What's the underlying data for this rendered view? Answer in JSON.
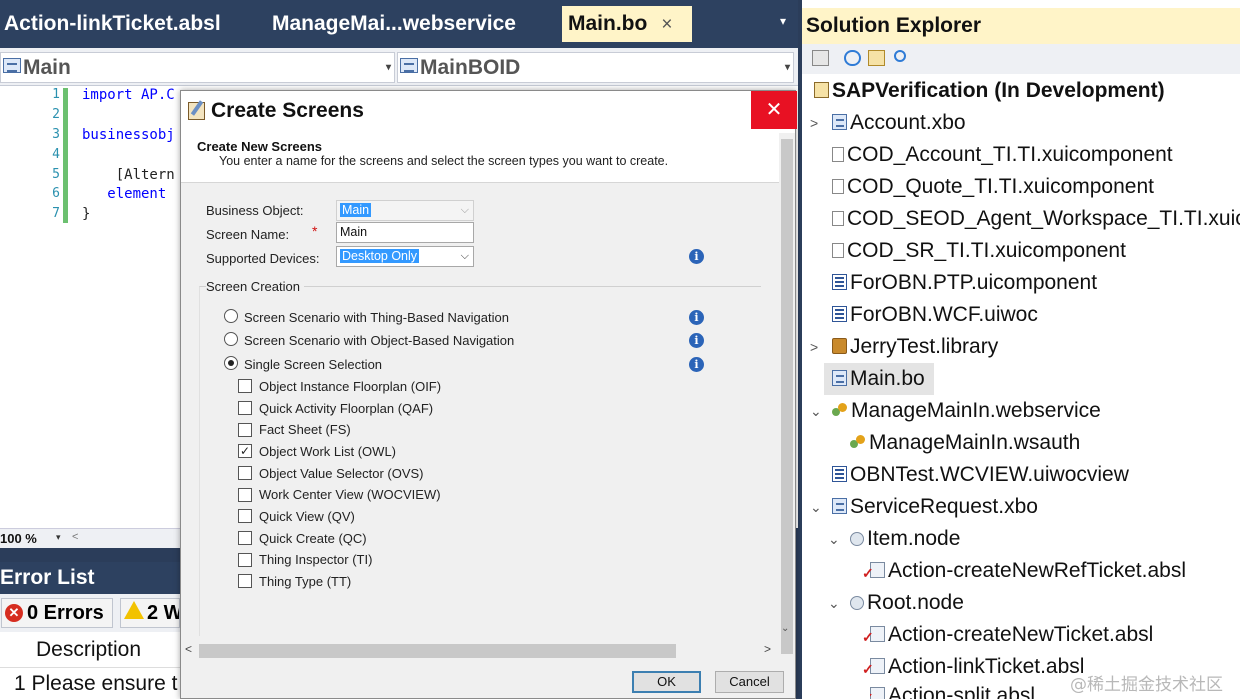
{
  "tabs": [
    {
      "label": "Action-linkTicket.absl"
    },
    {
      "label": "ManageMai...webservice"
    },
    {
      "label": "Main.bo",
      "close": "×"
    }
  ],
  "tab_menu": "▾",
  "nav": {
    "left": "Main",
    "right": "MainBOID",
    "arrow": "▾"
  },
  "code": {
    "line_numbers": [
      "1",
      "2",
      "3",
      "4",
      "5",
      "6",
      "7"
    ],
    "lines": [
      "import AP.C",
      "",
      "businessobj",
      "",
      "    [Altern",
      "   element",
      "}"
    ]
  },
  "zoom": {
    "value": "100 %",
    "arrow": "▾",
    "scroll_left": "<"
  },
  "error_list": {
    "title": "Error List",
    "errors_label": "0 Errors",
    "errors_icon": "✕",
    "warnings_label": "2 W",
    "column_description": "Description",
    "row_text": "1  Please ensure t"
  },
  "dialog": {
    "title": "Create Screens",
    "close": "✕",
    "header_title": "Create New Screens",
    "header_desc": "You enter a name for the screens and select the screen types you want to create.",
    "business_object_label": "Business Object:",
    "business_object_value": "Main",
    "screen_name_label": "Screen Name:",
    "required_mark": "*",
    "screen_name_value": "Main",
    "supported_devices_label": "Supported Devices:",
    "supported_devices_value": "Desktop Only",
    "combo_arrow": "⌵",
    "info_glyph": "i",
    "screen_creation_label": "Screen Creation",
    "radios": [
      {
        "label": "Screen Scenario with Thing-Based Navigation",
        "checked": false
      },
      {
        "label": "Screen Scenario with Object-Based Navigation",
        "checked": false
      },
      {
        "label": "Single Screen Selection",
        "checked": true
      }
    ],
    "checkboxes": [
      {
        "label": "Object Instance Floorplan (OIF)",
        "mark": ""
      },
      {
        "label": "Quick Activity Floorplan (QAF)",
        "mark": ""
      },
      {
        "label": "Fact Sheet (FS)",
        "mark": ""
      },
      {
        "label": "Object Work List (OWL)",
        "mark": "✓"
      },
      {
        "label": "Object Value Selector (OVS)",
        "mark": ""
      },
      {
        "label": "Work Center View (WOCVIEW)",
        "mark": ""
      },
      {
        "label": "Quick View (QV)",
        "mark": ""
      },
      {
        "label": "Quick Create (QC)",
        "mark": ""
      },
      {
        "label": "Thing Inspector (TI)",
        "mark": ""
      },
      {
        "label": "Thing Type (TT)",
        "mark": ""
      }
    ],
    "scroll_left": "<",
    "scroll_right": ">",
    "scroll_down": "⌄",
    "ok_label": "OK",
    "cancel_label": "Cancel"
  },
  "solution_explorer": {
    "title": "Solution Explorer",
    "items": [
      {
        "label": "SAPVerification (In Development)",
        "icon": "solution-icon"
      },
      {
        "label": "Account.xbo",
        "icon": "xbo-icon",
        "expander": ">"
      },
      {
        "label": "COD_Account_TI.TI.xuicomponent",
        "icon": "file-icon"
      },
      {
        "label": "COD_Quote_TI.TI.xuicomponent",
        "icon": "file-icon"
      },
      {
        "label": "COD_SEOD_Agent_Workspace_TI.TI.xuico",
        "icon": "file-icon"
      },
      {
        "label": "COD_SR_TI.TI.xuicomponent",
        "icon": "file-icon"
      },
      {
        "label": "ForOBN.PTP.uicomponent",
        "icon": "uicomponent-icon"
      },
      {
        "label": "ForOBN.WCF.uiwoc",
        "icon": "uiwoc-icon"
      },
      {
        "label": "JerryTest.library",
        "icon": "library-icon",
        "expander": ">"
      },
      {
        "label": "Main.bo",
        "icon": "bo-icon"
      },
      {
        "label": "ManageMainIn.webservice",
        "icon": "webservice-icon",
        "expander": "⌄"
      },
      {
        "label": "ManageMainIn.wsauth",
        "icon": "wsauth-icon"
      },
      {
        "label": "OBNTest.WCVIEW.uiwocview",
        "icon": "uiwocview-icon"
      },
      {
        "label": "ServiceRequest.xbo",
        "icon": "xbo-icon",
        "expander": "⌄"
      },
      {
        "label": "Item.node",
        "icon": "node-icon",
        "expander": "⌄"
      },
      {
        "label": "Action-createNewRefTicket.absl",
        "icon": "absl-icon"
      },
      {
        "label": "Root.node",
        "icon": "node-icon",
        "expander": "⌄"
      },
      {
        "label": "Action-createNewTicket.absl",
        "icon": "absl-icon"
      },
      {
        "label": "Action-linkTicket.absl",
        "icon": "absl-icon"
      },
      {
        "label": "Action-split.absl",
        "icon": "absl-icon"
      }
    ]
  },
  "watermark": "@稀土掘金技术社区"
}
